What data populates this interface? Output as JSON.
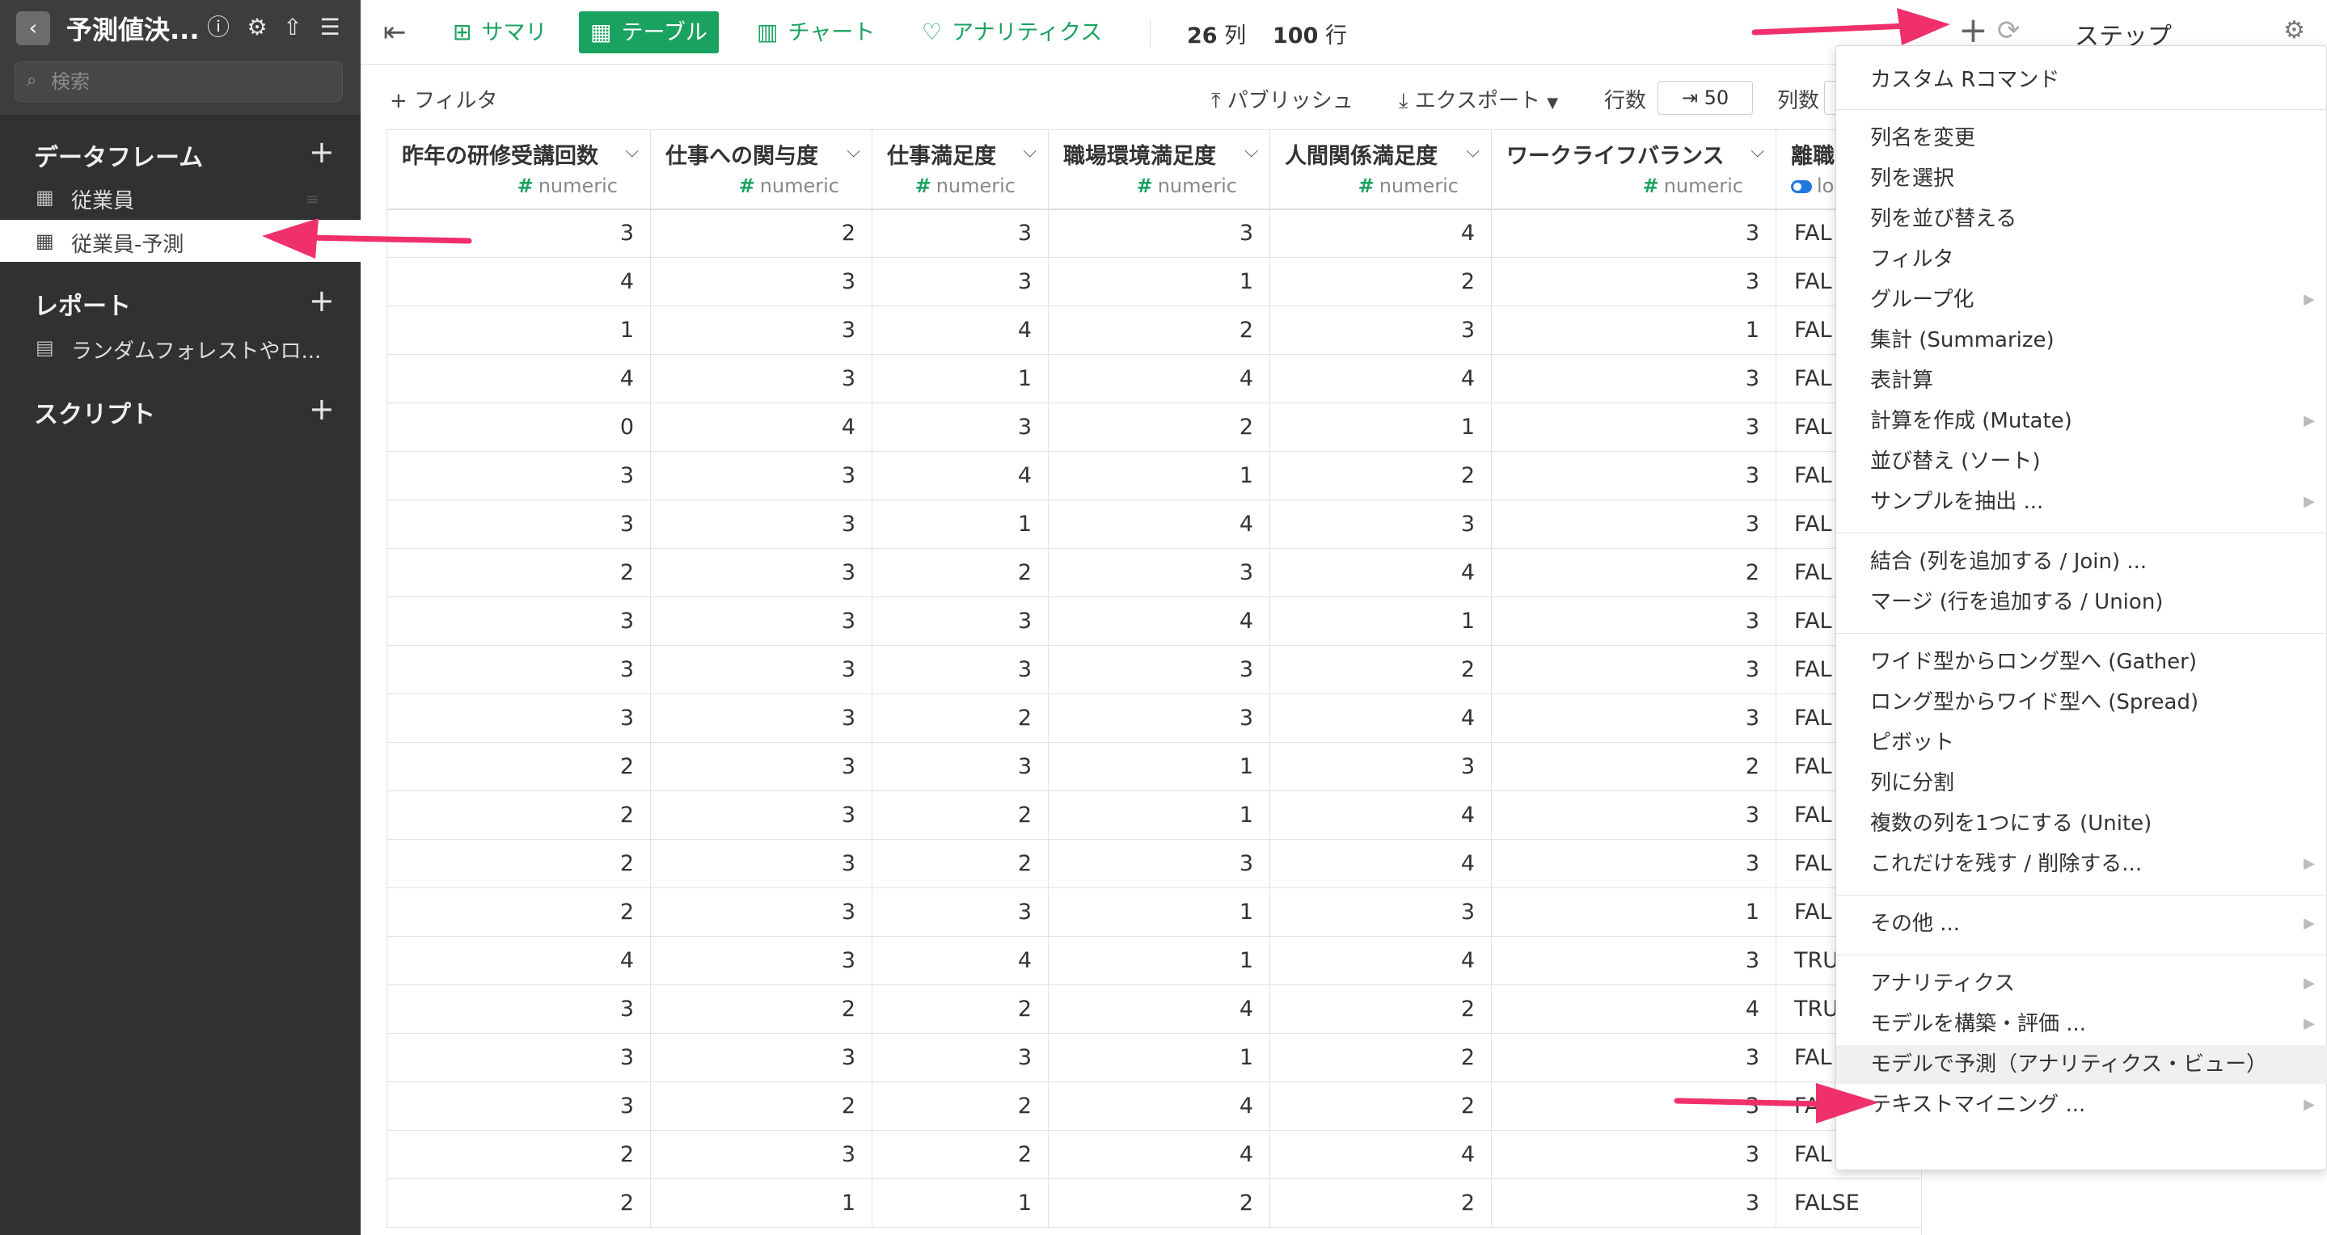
{
  "sidebar": {
    "title": "予測値決...",
    "search_placeholder": "検索",
    "sections": {
      "dataframes": {
        "title": "データフレーム",
        "items": [
          "従業員",
          "従業員-予測"
        ]
      },
      "reports": {
        "title": "レポート",
        "items": [
          "ランダムフォレストやロ..."
        ]
      },
      "scripts": {
        "title": "スクリプト"
      }
    }
  },
  "toolbar": {
    "tabs": [
      "サマリ",
      "テーブル",
      "チャート",
      "アナリティクス"
    ],
    "cols_count": "26",
    "cols_unit": "列",
    "rows_count": "100",
    "rows_unit": "行",
    "step_label": "ステップ"
  },
  "subbar": {
    "filter": "+ フィルタ",
    "publish": "パブリッシュ",
    "export": "エクスポート",
    "rows_label": "行数",
    "rows_value": "⇥ 50",
    "cols_label": "列数"
  },
  "table": {
    "columns": [
      {
        "name": "昨年の研修受講回数",
        "type": "numeric"
      },
      {
        "name": "仕事への関与度",
        "type": "numeric"
      },
      {
        "name": "仕事満足度",
        "type": "numeric"
      },
      {
        "name": "職場環境満足度",
        "type": "numeric"
      },
      {
        "name": "人間関係満足度",
        "type": "numeric"
      },
      {
        "name": "ワークライフバランス",
        "type": "numeric"
      },
      {
        "name": "離職",
        "type": "lo"
      }
    ],
    "rows": [
      [
        "3",
        "2",
        "3",
        "3",
        "4",
        "3",
        "FAL"
      ],
      [
        "4",
        "3",
        "3",
        "1",
        "2",
        "3",
        "FAL"
      ],
      [
        "1",
        "3",
        "4",
        "2",
        "3",
        "1",
        "FAL"
      ],
      [
        "4",
        "3",
        "1",
        "4",
        "4",
        "3",
        "FAL"
      ],
      [
        "0",
        "4",
        "3",
        "2",
        "1",
        "3",
        "FAL"
      ],
      [
        "3",
        "3",
        "4",
        "1",
        "2",
        "3",
        "FAL"
      ],
      [
        "3",
        "3",
        "1",
        "4",
        "3",
        "3",
        "FAL"
      ],
      [
        "2",
        "3",
        "2",
        "3",
        "4",
        "2",
        "FAL"
      ],
      [
        "3",
        "3",
        "3",
        "4",
        "1",
        "3",
        "FAL"
      ],
      [
        "3",
        "3",
        "3",
        "3",
        "2",
        "3",
        "FAL"
      ],
      [
        "3",
        "3",
        "2",
        "3",
        "4",
        "3",
        "FAL"
      ],
      [
        "2",
        "3",
        "3",
        "1",
        "3",
        "2",
        "FAL"
      ],
      [
        "2",
        "3",
        "2",
        "1",
        "4",
        "3",
        "FAL"
      ],
      [
        "2",
        "3",
        "2",
        "3",
        "4",
        "3",
        "FAL"
      ],
      [
        "2",
        "3",
        "3",
        "1",
        "3",
        "1",
        "FAL"
      ],
      [
        "4",
        "3",
        "4",
        "1",
        "4",
        "3",
        "TRU"
      ],
      [
        "3",
        "2",
        "2",
        "4",
        "2",
        "4",
        "TRU"
      ],
      [
        "3",
        "3",
        "3",
        "1",
        "2",
        "3",
        "FAL"
      ],
      [
        "3",
        "2",
        "2",
        "4",
        "2",
        "3",
        "FAL"
      ],
      [
        "2",
        "3",
        "2",
        "4",
        "4",
        "3",
        "FAL"
      ],
      [
        "2",
        "1",
        "1",
        "2",
        "2",
        "3",
        "FALSE"
      ]
    ]
  },
  "menu": {
    "items": [
      {
        "label": "カスタム Rコマンド",
        "sub": false
      },
      {
        "label": "列名を変更",
        "sub": false
      },
      {
        "label": "列を選択",
        "sub": false
      },
      {
        "label": "列を並び替える",
        "sub": false
      },
      {
        "label": "フィルタ",
        "sub": false
      },
      {
        "label": "グループ化",
        "sub": true
      },
      {
        "label": "集計 (Summarize)",
        "sub": false
      },
      {
        "label": "表計算",
        "sub": false
      },
      {
        "label": "計算を作成 (Mutate)",
        "sub": true
      },
      {
        "label": "並び替え (ソート)",
        "sub": false
      },
      {
        "label": "サンプルを抽出 ...",
        "sub": true
      },
      {
        "label": "結合 (列を追加する / Join) ...",
        "sub": false
      },
      {
        "label": "マージ (行を追加する / Union)",
        "sub": false
      },
      {
        "label": "ワイド型からロング型へ (Gather)",
        "sub": false
      },
      {
        "label": "ロング型からワイド型へ (Spread)",
        "sub": false
      },
      {
        "label": "ピボット",
        "sub": false
      },
      {
        "label": "列に分割",
        "sub": false
      },
      {
        "label": "複数の列を1つにする (Unite)",
        "sub": false
      },
      {
        "label": "これだけを残す / 削除する...",
        "sub": true
      },
      {
        "label": "その他 ...",
        "sub": true
      },
      {
        "label": "アナリティクス",
        "sub": true
      },
      {
        "label": "モデルを構築・評価 ...",
        "sub": true
      },
      {
        "label": "モデルで予測（アナリティクス・ビュー）",
        "sub": false
      },
      {
        "label": "テキストマイニング ...",
        "sub": true
      }
    ]
  },
  "colors": {
    "accent": "#1aa260",
    "sidebar": "#2f3132",
    "annotation": "#f0306a"
  }
}
